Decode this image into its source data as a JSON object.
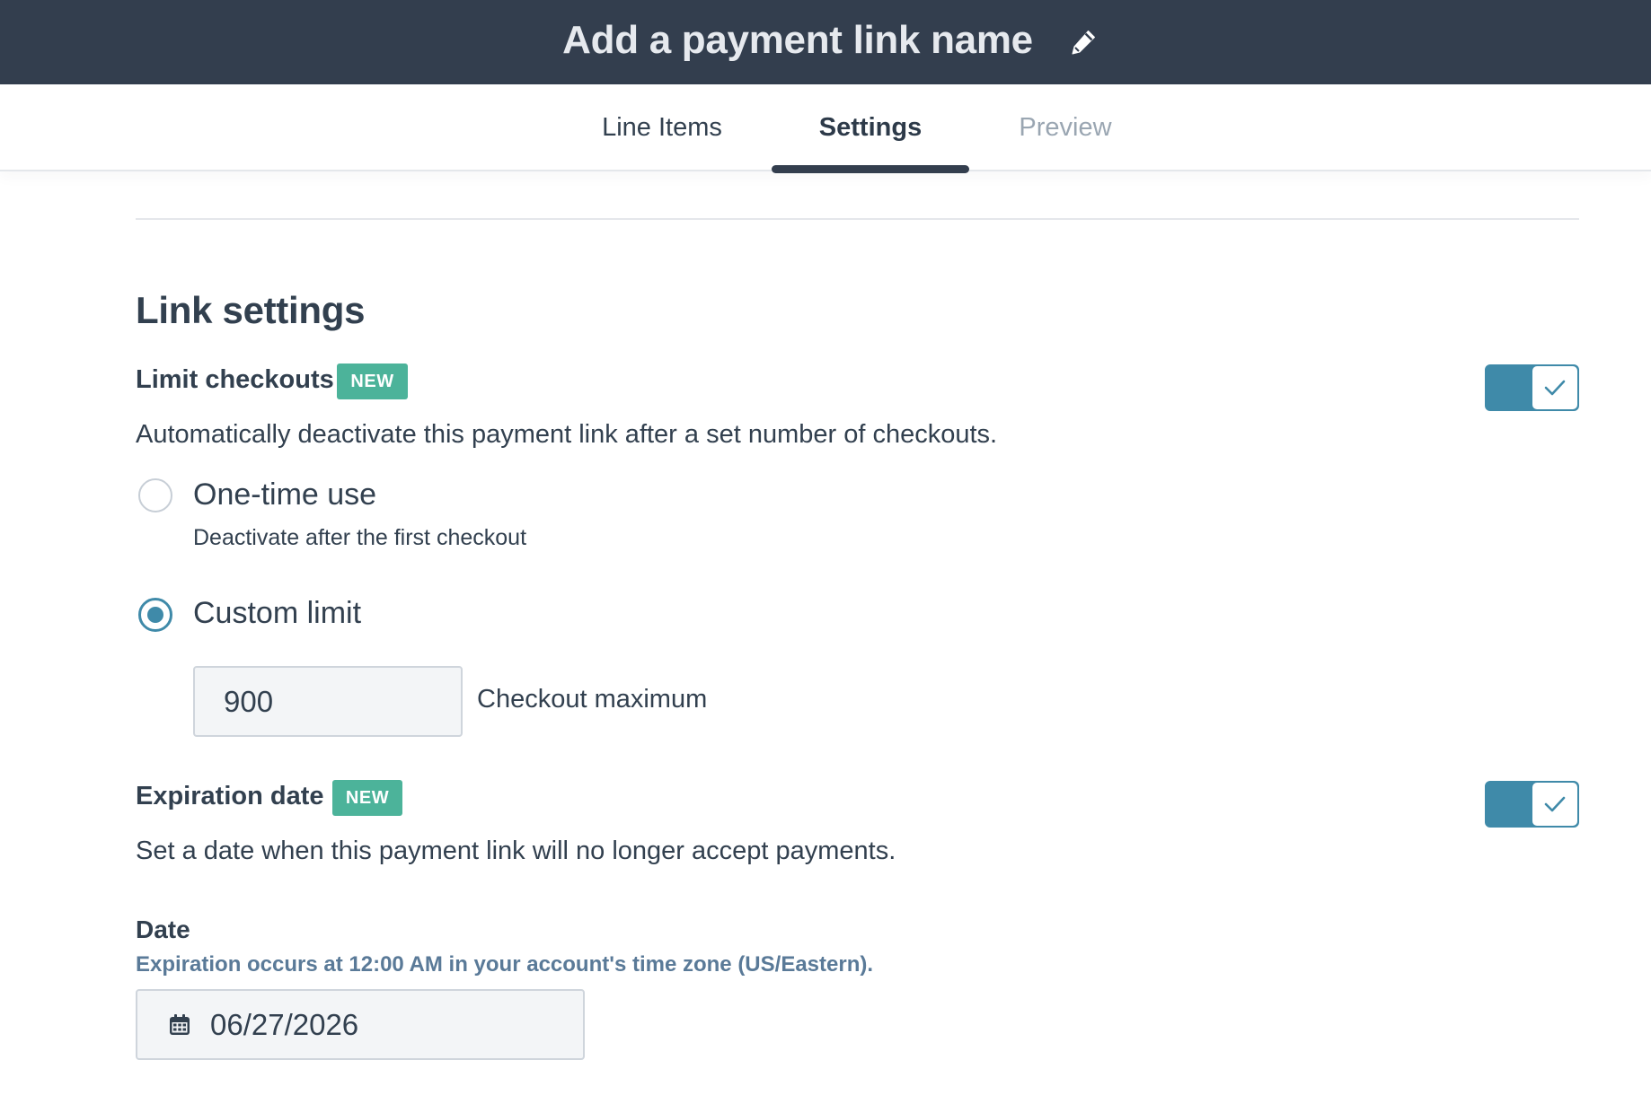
{
  "header": {
    "title": "Add a payment link name",
    "edit_icon": "pencil-icon"
  },
  "tabs": [
    {
      "label": "Line Items",
      "state": "default"
    },
    {
      "label": "Settings",
      "state": "active"
    },
    {
      "label": "Preview",
      "state": "disabled"
    }
  ],
  "link_settings": {
    "title": "Link settings",
    "limit_checkouts": {
      "label": "Limit checkouts",
      "badge": "NEW",
      "description": "Automatically deactivate this payment link after a set number of checkouts.",
      "enabled": true,
      "options": [
        {
          "label": "One-time use",
          "sublabel": "Deactivate after the first checkout",
          "selected": false
        },
        {
          "label": "Custom limit",
          "selected": true
        }
      ],
      "custom_limit_value": "900",
      "custom_limit_suffix": "Checkout maximum"
    },
    "expiration_date": {
      "label": "Expiration date",
      "badge": "NEW",
      "description": "Set a date when this payment link will no longer accept payments.",
      "enabled": true,
      "date_label": "Date",
      "help_text": "Expiration occurs at 12:00 AM in your account's time zone (US/Eastern).",
      "date_value": "06/27/2026",
      "date_icon": "calendar-icon"
    }
  },
  "colors": {
    "header_bg": "#333e4e",
    "accent": "#3f8aa9",
    "badge_bg": "#4cb39a",
    "help_text": "#5a7a98"
  }
}
